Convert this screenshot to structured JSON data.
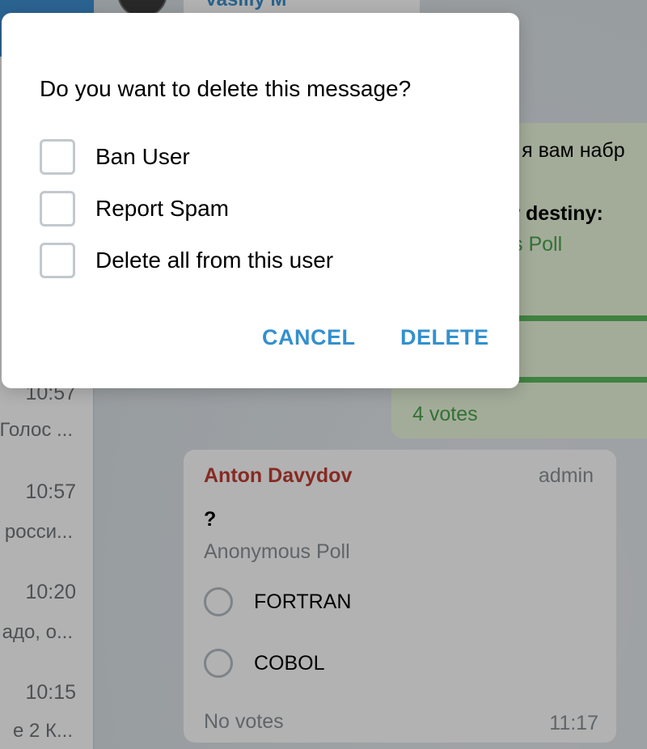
{
  "sidebar": {
    "chats": [
      {
        "time": "10:57",
        "snippet": "Голос ..."
      },
      {
        "time": "10:57",
        "snippet": "росси..."
      },
      {
        "time": "10:20",
        "snippet": "адо, о..."
      },
      {
        "time": "10:15",
        "snippet": "е 2  К..."
      }
    ]
  },
  "chat": {
    "top_message": {
      "sender": "Vasiliy M"
    },
    "green_message": {
      "text": "ца я вам набр",
      "question_fragment": "ur destiny:",
      "poll_kind_fragment": "s Poll",
      "votes": "4 votes"
    },
    "poll_message": {
      "sender": "Anton Davydov",
      "role": "admin",
      "question": "?",
      "poll_kind": "Anonymous Poll",
      "options": [
        "FORTRAN",
        "COBOL"
      ],
      "footer": "No votes",
      "time": "11:17"
    }
  },
  "dialog": {
    "title": "Do you want to delete this message?",
    "options": [
      {
        "label": "Ban User",
        "checked": false
      },
      {
        "label": "Report Spam",
        "checked": false
      },
      {
        "label": "Delete all from this user",
        "checked": false
      }
    ],
    "cancel_label": "CANCEL",
    "delete_label": "DELETE"
  },
  "colors": {
    "accent": "#3390ce",
    "sender_red": "#c03d33",
    "poll_green": "#4aa34c"
  }
}
